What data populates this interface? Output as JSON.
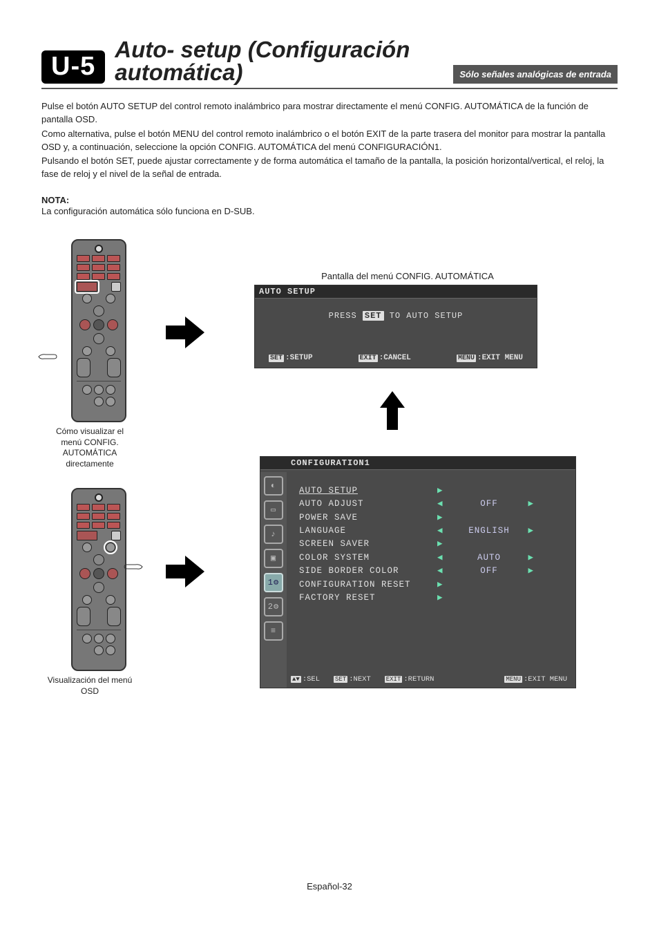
{
  "header": {
    "section_tag": "U-5",
    "title": "Auto- setup (Configuración automática)",
    "subtitle": "Sólo señales analógicas de entrada"
  },
  "paragraphs": {
    "p1": "Pulse el botón AUTO SETUP del control remoto inalámbrico para mostrar directamente el menú CONFIG. AUTOMÁTICA de la función de pantalla OSD.",
    "p2": "Como alternativa, pulse el botón MENU del control remoto inalámbrico o el botón EXIT de la parte trasera del monitor para mostrar la pantalla OSD y, a continuación, seleccione la opción CONFIG. AUTOMÁTICA del menú CONFIGURACIÓN1.",
    "p3": "Pulsando el botón SET, puede ajustar correctamente y de forma automática el tamaño de la pantalla, la posición horizontal/vertical, el reloj, la fase de reloj y el nivel de la señal de entrada."
  },
  "nota": {
    "label": "NOTA:",
    "text": "La configuración automática sólo funciona en D-SUB."
  },
  "captions": {
    "remote1": "Cómo visualizar el menú CONFIG. AUTOMÁTICA directamente",
    "remote2": "Visualización del menú OSD",
    "osd_title_label": "Pantalla del menú CONFIG. AUTOMÁTICA"
  },
  "osd_auto": {
    "titlebar": "AUTO SETUP",
    "center_pre": "PRESS ",
    "center_btn": "SET",
    "center_post": " TO AUTO SETUP",
    "footer": [
      {
        "box": "SET",
        "text": ":SETUP"
      },
      {
        "box": "EXIT",
        "text": ":CANCEL"
      },
      {
        "box": "MENU",
        "text": ":EXIT MENU"
      }
    ]
  },
  "osd_config": {
    "titlebar": "CONFIGURATION1",
    "items": [
      {
        "name": "AUTO SETUP",
        "left": "",
        "value": "",
        "right": "▶",
        "underline": true
      },
      {
        "name": "AUTO ADJUST",
        "left": "◀",
        "value": "OFF",
        "right": "▶"
      },
      {
        "name": "POWER SAVE",
        "left": "",
        "value": "",
        "right": "▶"
      },
      {
        "name": "LANGUAGE",
        "left": "◀",
        "value": "ENGLISH",
        "right": "▶"
      },
      {
        "name": "SCREEN SAVER",
        "left": "",
        "value": "",
        "right": "▶"
      },
      {
        "name": "COLOR SYSTEM",
        "left": "◀",
        "value": "AUTO",
        "right": "▶"
      },
      {
        "name": "SIDE BORDER COLOR",
        "left": "◀",
        "value": "OFF",
        "right": "▶"
      },
      {
        "name": "CONFIGURATION RESET",
        "left": "",
        "value": "",
        "right": "▶"
      },
      {
        "name": "FACTORY RESET",
        "left": "",
        "value": "",
        "right": "▶"
      }
    ],
    "footer": [
      {
        "box": "▲▼",
        "text": ":SEL"
      },
      {
        "box": "SET",
        "text": ":NEXT"
      },
      {
        "box": "EXIT",
        "text": ":RETURN"
      },
      {
        "box": "MENU",
        "text": ":EXIT MENU"
      }
    ]
  },
  "page_number": "Español-32"
}
